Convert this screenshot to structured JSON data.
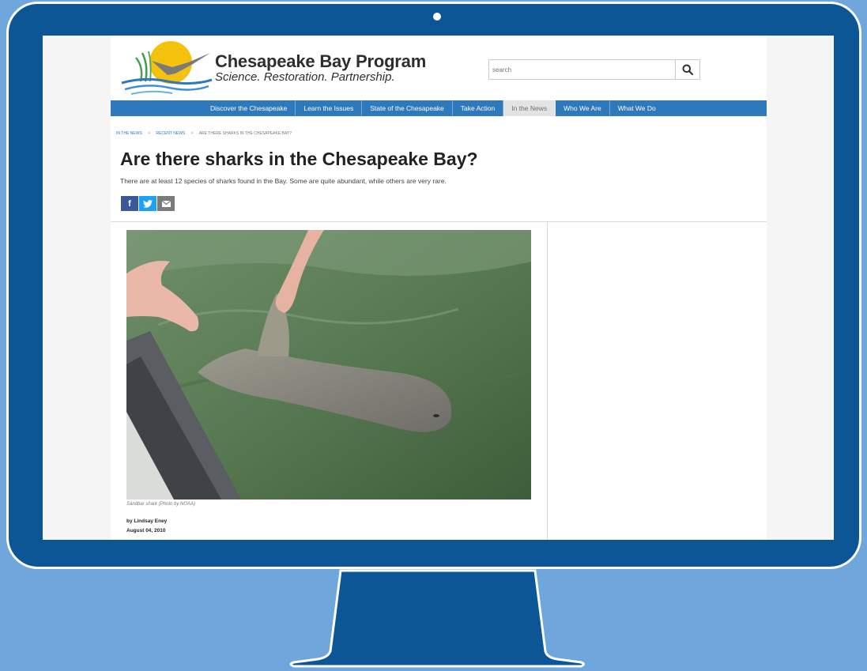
{
  "site": {
    "title": "Chesapeake Bay Program",
    "tagline": "Science. Restoration. Partnership."
  },
  "search": {
    "placeholder": "search"
  },
  "nav": {
    "items": [
      {
        "label": "Discover the Chesapeake",
        "active": false
      },
      {
        "label": "Learn the Issues",
        "active": false
      },
      {
        "label": "State of the Chesapeake",
        "active": false
      },
      {
        "label": "Take Action",
        "active": false
      },
      {
        "label": "In the News",
        "active": true
      },
      {
        "label": "Who We Are",
        "active": false
      },
      {
        "label": "What We Do",
        "active": false
      }
    ]
  },
  "breadcrumb": {
    "items": [
      "IN THE NEWS",
      "RECENT NEWS"
    ],
    "current": "ARE THERE SHARKS IN THE CHESAPEAKE BAY?",
    "separator": ">"
  },
  "article": {
    "title": "Are there sharks in the Chesapeake Bay?",
    "lede": "There are at least 12 species of sharks found in the Bay. Some are quite abundant, while others are very rare.",
    "photo_caption": "Sandbar shark (Photo by NOAA)",
    "byline": "by Lindsay Eney",
    "date": "August 04, 2010"
  },
  "share": {
    "facebook": "f",
    "twitter_icon": "twitter-icon",
    "email_icon": "envelope-icon"
  },
  "colors": {
    "background": "#6fa6dc",
    "monitor": "#0d5696",
    "nav": "#2e79bc",
    "facebook": "#3b5998",
    "twitter": "#1da1f2",
    "email": "#7b7b7b"
  }
}
